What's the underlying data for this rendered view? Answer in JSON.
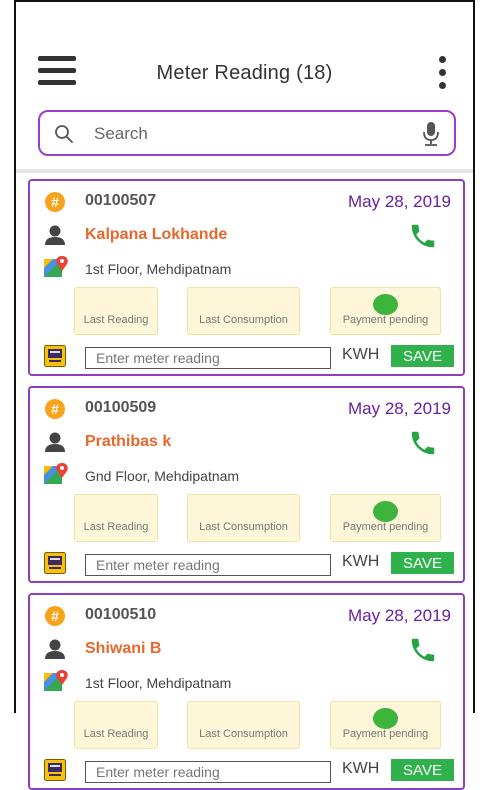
{
  "header": {
    "title": "Meter Reading (18)"
  },
  "search": {
    "placeholder": "Search"
  },
  "colors": {
    "accent": "#8c3fc1",
    "name": "#e8672c",
    "date": "#6a1fa0",
    "save": "#2fb24c",
    "status_dot": "#3db53d"
  },
  "icons": [
    "menu-icon",
    "more-vert-icon",
    "search-icon",
    "mic-icon",
    "hash-badge-icon",
    "person-icon",
    "phone-icon",
    "map-pin-icon",
    "meter-icon"
  ],
  "cards": [
    {
      "account": "00100507",
      "date": "May 28, 2019",
      "name": "Kalpana Lokhande",
      "address": "1st Floor, Mehdipatnam",
      "last_reading_label": "Last Reading",
      "last_consumption_label": "Last Consumption",
      "payment_label": "Payment pending",
      "input_placeholder": "Enter meter reading",
      "unit": "KWH",
      "save_label": "SAVE"
    },
    {
      "account": "00100509",
      "date": "May 28, 2019",
      "name": "Prathibas k",
      "address": "Gnd Floor, Mehdipatnam",
      "last_reading_label": "Last Reading",
      "last_consumption_label": "Last Consumption",
      "payment_label": "Payment pending",
      "input_placeholder": "Enter meter reading",
      "unit": "KWH",
      "save_label": "SAVE"
    },
    {
      "account": "00100510",
      "date": "May 28, 2019",
      "name": "Shiwani B",
      "address": "1st Floor, Mehdipatnam",
      "last_reading_label": "Last Reading",
      "last_consumption_label": "Last Consumption",
      "payment_label": "Payment pending",
      "input_placeholder": "Enter meter reading",
      "unit": "KWH",
      "save_label": "SAVE"
    }
  ]
}
